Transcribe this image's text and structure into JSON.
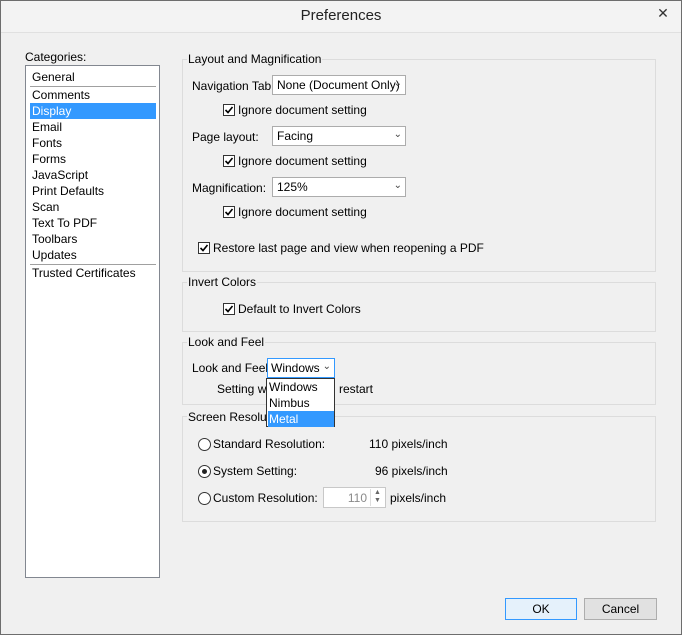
{
  "window": {
    "title": "Preferences",
    "close_glyph": "✕"
  },
  "categories": {
    "label": "Categories:",
    "items": [
      "General",
      "Comments",
      "Display",
      "Email",
      "Fonts",
      "Forms",
      "JavaScript",
      "Print Defaults",
      "Scan",
      "Text To PDF",
      "Toolbars",
      "Updates",
      "Trusted Certificates"
    ],
    "selected": "Display"
  },
  "layout_group": {
    "title": "Layout and Magnification",
    "navigation_tab_label": "Navigation Tab:",
    "navigation_tab_value": "None (Document Only)",
    "page_layout_label": "Page layout:",
    "page_layout_value": "Facing",
    "magnification_label": "Magnification:",
    "magnification_value": "125%",
    "ignore_label": "Ignore document setting",
    "restore_label": "Restore last page and view when reopening a PDF"
  },
  "invert_group": {
    "title": "Invert Colors",
    "default_invert_label": "Default to Invert Colors"
  },
  "look_group": {
    "title": "Look and Feel",
    "look_label": "Look and Feel:",
    "look_value": "Windows",
    "setting_note_start": "Setting wil",
    "setting_note_end": "restart",
    "dropdown_options": [
      "Windows",
      "Nimbus",
      "Metal"
    ],
    "dropdown_highlighted": "Metal"
  },
  "resolution_group": {
    "title": "Screen Resolutio",
    "standard_label": "Standard Resolution:",
    "standard_value": "110 pixels/inch",
    "system_label": "System Setting:",
    "system_value": "96 pixels/inch",
    "custom_label": "Custom Resolution:",
    "custom_value": "110",
    "custom_unit": "pixels/inch",
    "selected": "system"
  },
  "buttons": {
    "ok": "OK",
    "cancel": "Cancel"
  }
}
